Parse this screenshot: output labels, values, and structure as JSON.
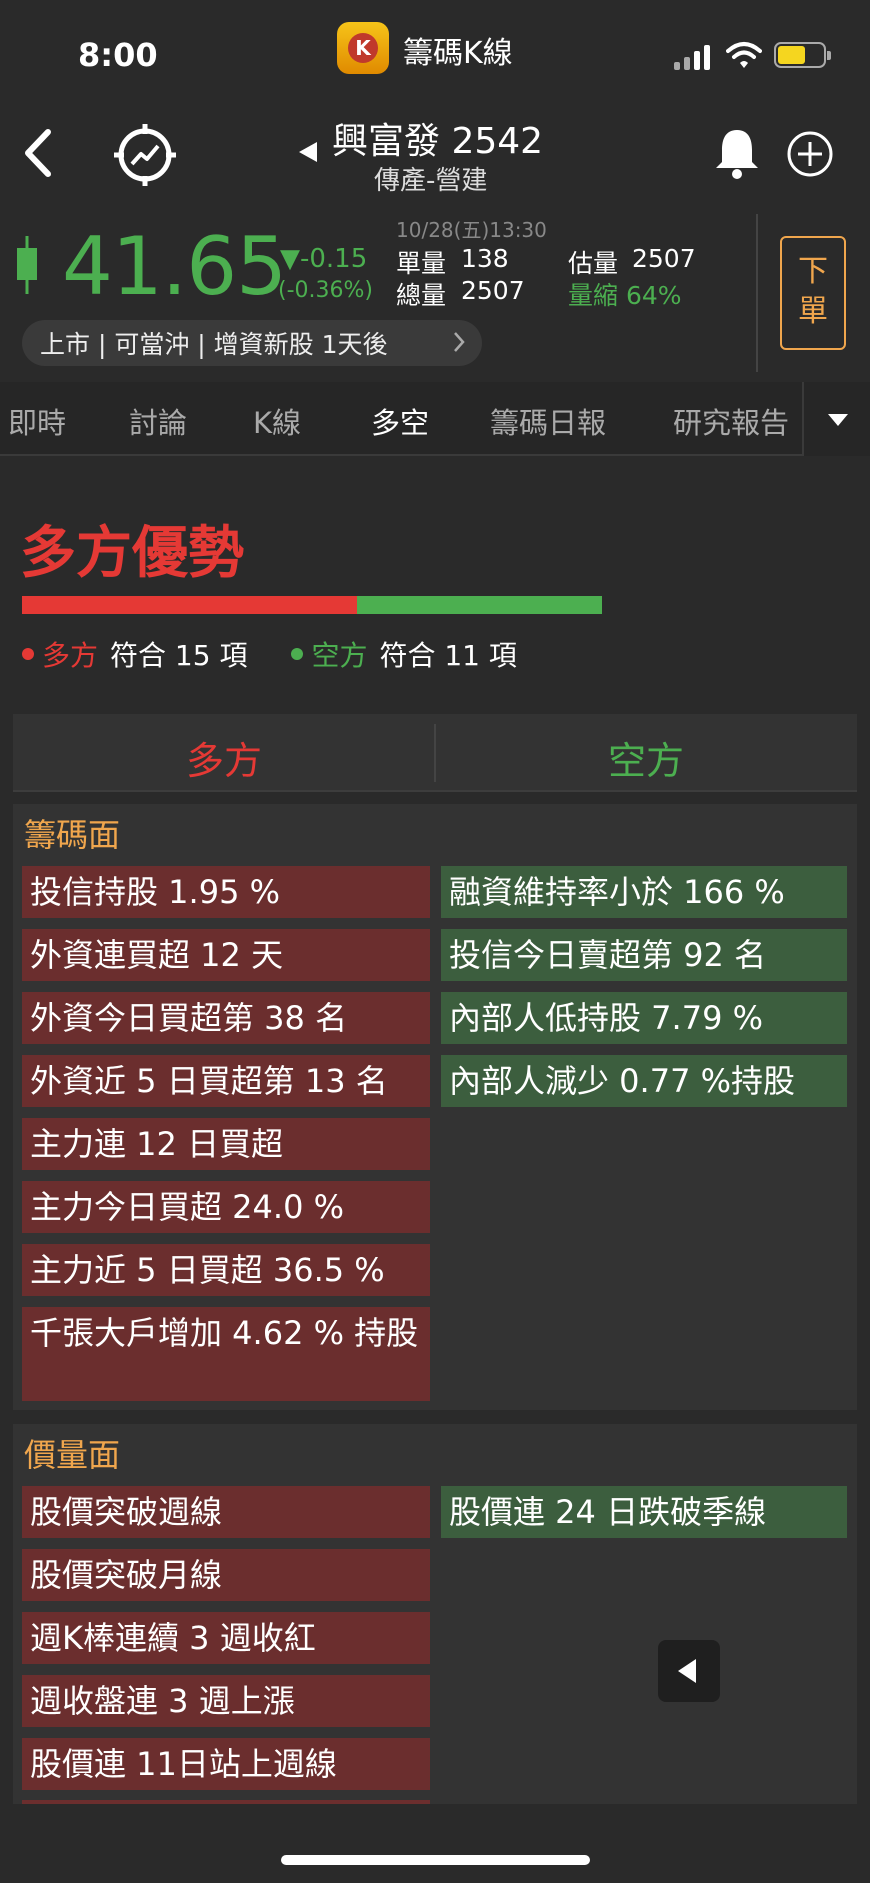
{
  "status_bar": {
    "time": "8:00",
    "app_name": "籌碼K線"
  },
  "header": {
    "stock_title": "興富發 2542",
    "industry": "傳產-營建"
  },
  "quote": {
    "price": "41.65",
    "change": "▼-0.15",
    "change_pct": "(-0.36%)",
    "datetime": "10/28(五)13:30",
    "unit_volume_label": "單量",
    "unit_volume": "138",
    "est_volume_label": "估量",
    "est_volume": "2507",
    "total_volume_label": "總量",
    "total_volume": "2507",
    "volume_shrink": "量縮 64%",
    "order_button": "下單",
    "info_pill": "上市 | 可當沖 | 增資新股 1天後"
  },
  "tabs": [
    "即時",
    "討論",
    "K線",
    "多空",
    "籌碼日報",
    "研究報告"
  ],
  "active_tab": "多空",
  "verdict": {
    "title": "多方優勢",
    "bull_count": 15,
    "bear_count": 11,
    "bull_label": "多方",
    "bear_label": "空方",
    "bull_text": "符合 15 項",
    "bear_text": "符合 11 項"
  },
  "side_header": {
    "bull": "多方",
    "bear": "空方"
  },
  "sections": {
    "chips": {
      "title": "籌碼面",
      "bull": [
        "投信持股 1.95 %",
        "外資連買超 12 天",
        "外資今日買超第 38 名",
        "外資近 5 日買超第 13 名",
        "主力連 12 日買超",
        "主力今日買超 24.0 %",
        "主力近 5 日買超 36.5 %",
        "千張大戶增加 4.62 % 持股"
      ],
      "bear": [
        "融資維持率小於 166 %",
        "投信今日賣超第 92 名",
        "內部人低持股 7.79 %",
        "內部人減少 0.77 %持股"
      ]
    },
    "price_volume": {
      "title": "價量面",
      "bull": [
        "股價突破週線",
        "股價突破月線",
        "週K棒連續 3 週收紅",
        "週收盤連 3 週上漲",
        "股價連 11日站上週線"
      ],
      "bear": [
        "股價連 24 日跌破季線"
      ]
    }
  },
  "colors": {
    "bull": "#e53935",
    "bear": "#4caf50",
    "accent": "#f0a64d",
    "bg": "#2a2a2a"
  }
}
